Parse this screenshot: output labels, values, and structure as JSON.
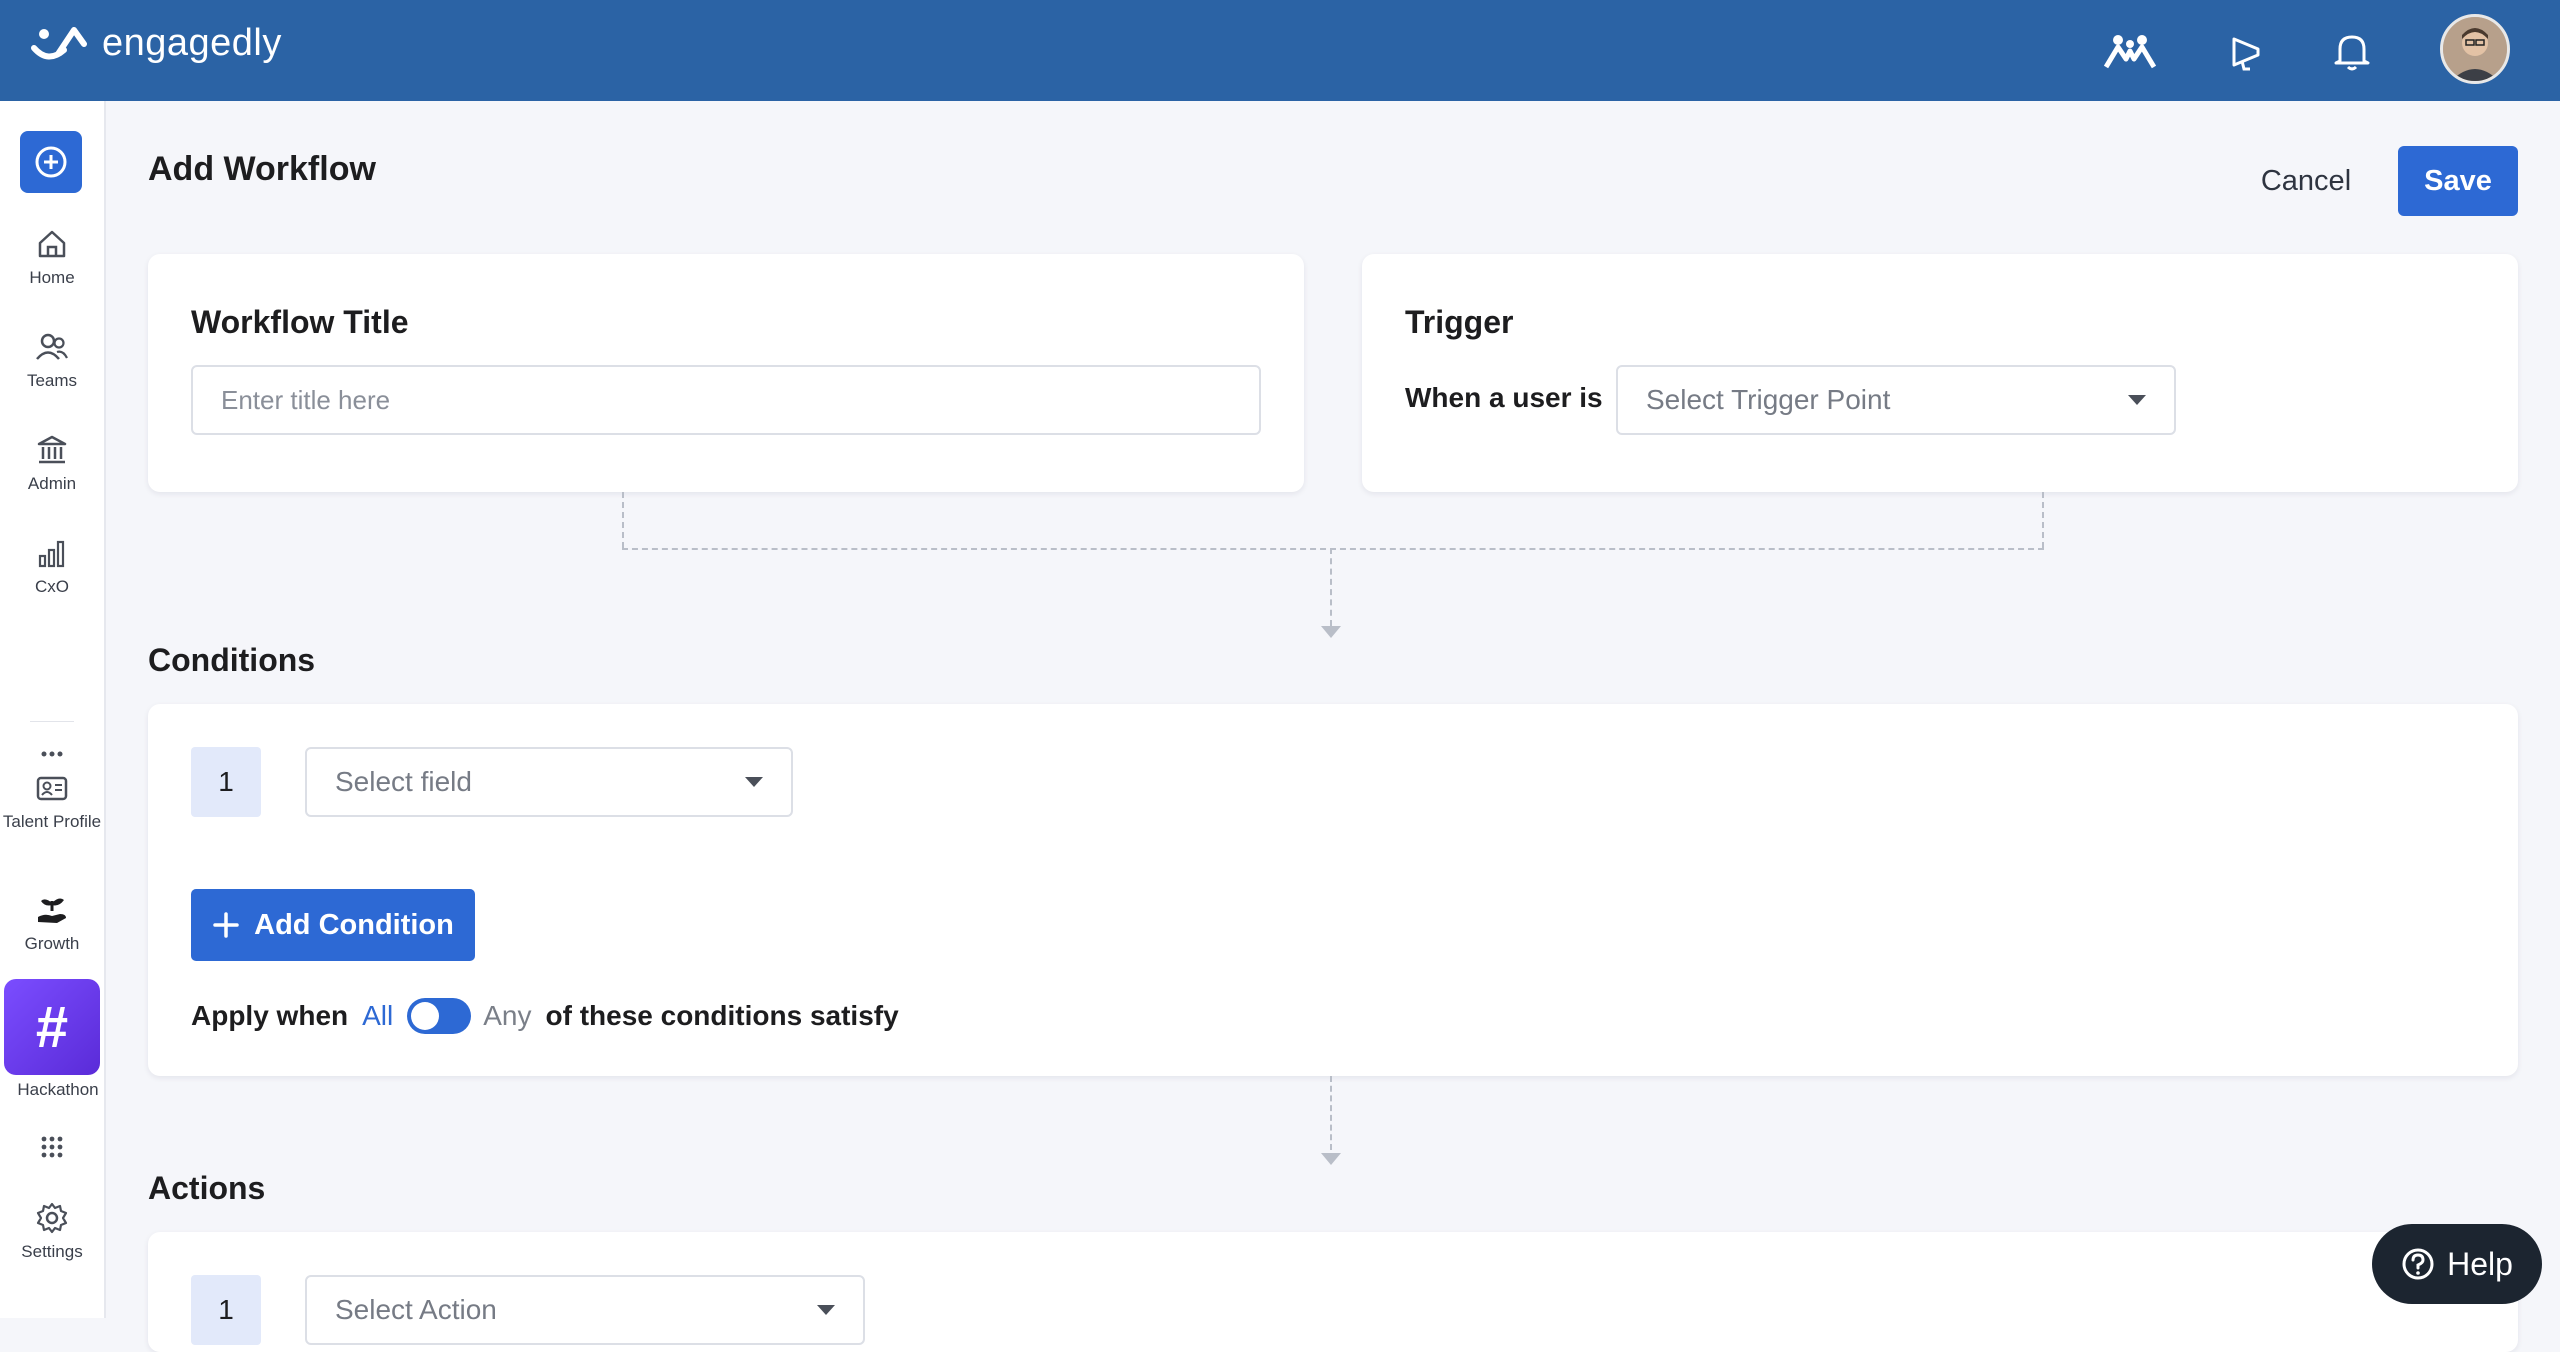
{
  "app": {
    "brand": "engagedly"
  },
  "header": {
    "avatar_alt": "user avatar"
  },
  "sidebar": {
    "items": [
      {
        "label": "Home"
      },
      {
        "label": "Teams"
      },
      {
        "label": "Admin"
      },
      {
        "label": "CxO"
      },
      {
        "label": "Talent Profile"
      },
      {
        "label": "Growth"
      },
      {
        "label": "Hackathon"
      },
      {
        "label": "Settings"
      }
    ],
    "hackathon_glyph": "#"
  },
  "page": {
    "title": "Add Workflow",
    "cancel_label": "Cancel",
    "save_label": "Save"
  },
  "workflow_title": {
    "heading": "Workflow Title",
    "placeholder": "Enter title here"
  },
  "trigger": {
    "heading": "Trigger",
    "label": "When a user is",
    "select_placeholder": "Select Trigger Point"
  },
  "conditions": {
    "heading": "Conditions",
    "rows": [
      {
        "number": "1",
        "field_placeholder": "Select field"
      }
    ],
    "add_label": "Add Condition",
    "apply_prefix": "Apply when",
    "option_all": "All",
    "option_any": "Any",
    "apply_suffix": "of these conditions satisfy",
    "selected": "All"
  },
  "actions": {
    "heading": "Actions",
    "rows": [
      {
        "number": "1",
        "action_placeholder": "Select Action"
      }
    ]
  },
  "help": {
    "label": "Help"
  },
  "colors": {
    "brand_bar": "#2b63a5",
    "primary": "#2d69d4",
    "hackathon": "#6a3cf0"
  }
}
